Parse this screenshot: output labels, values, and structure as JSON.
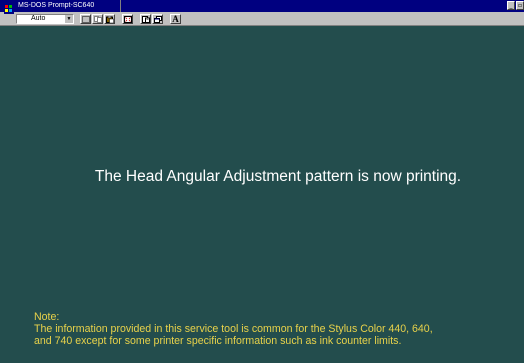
{
  "window": {
    "title": "MS-DOS Prompt-SC640",
    "minimize_icon": "minimize-icon",
    "restore_icon": "restore-icon"
  },
  "toolbar": {
    "font_size_value": "Auto",
    "buttons": [
      "mark-icon",
      "copy-icon",
      "paste-icon",
      "full-screen-icon",
      "properties-icon",
      "background-icon",
      "font-icon"
    ],
    "font_button_label": "A"
  },
  "screen": {
    "message": "The Head Angular Adjustment pattern is now printing.",
    "note_heading": "Note:",
    "note_line1": "The information provided in this service tool is common for the Stylus Color 440, 640,",
    "note_line2": "and 740 except for some printer specific information such as ink counter limits."
  },
  "colors": {
    "title_bar": "#000080",
    "screen_background": "#234d4d",
    "message_text": "#ffffff",
    "note_text": "#e8d24a",
    "toolbar": "#c0c0c0"
  }
}
